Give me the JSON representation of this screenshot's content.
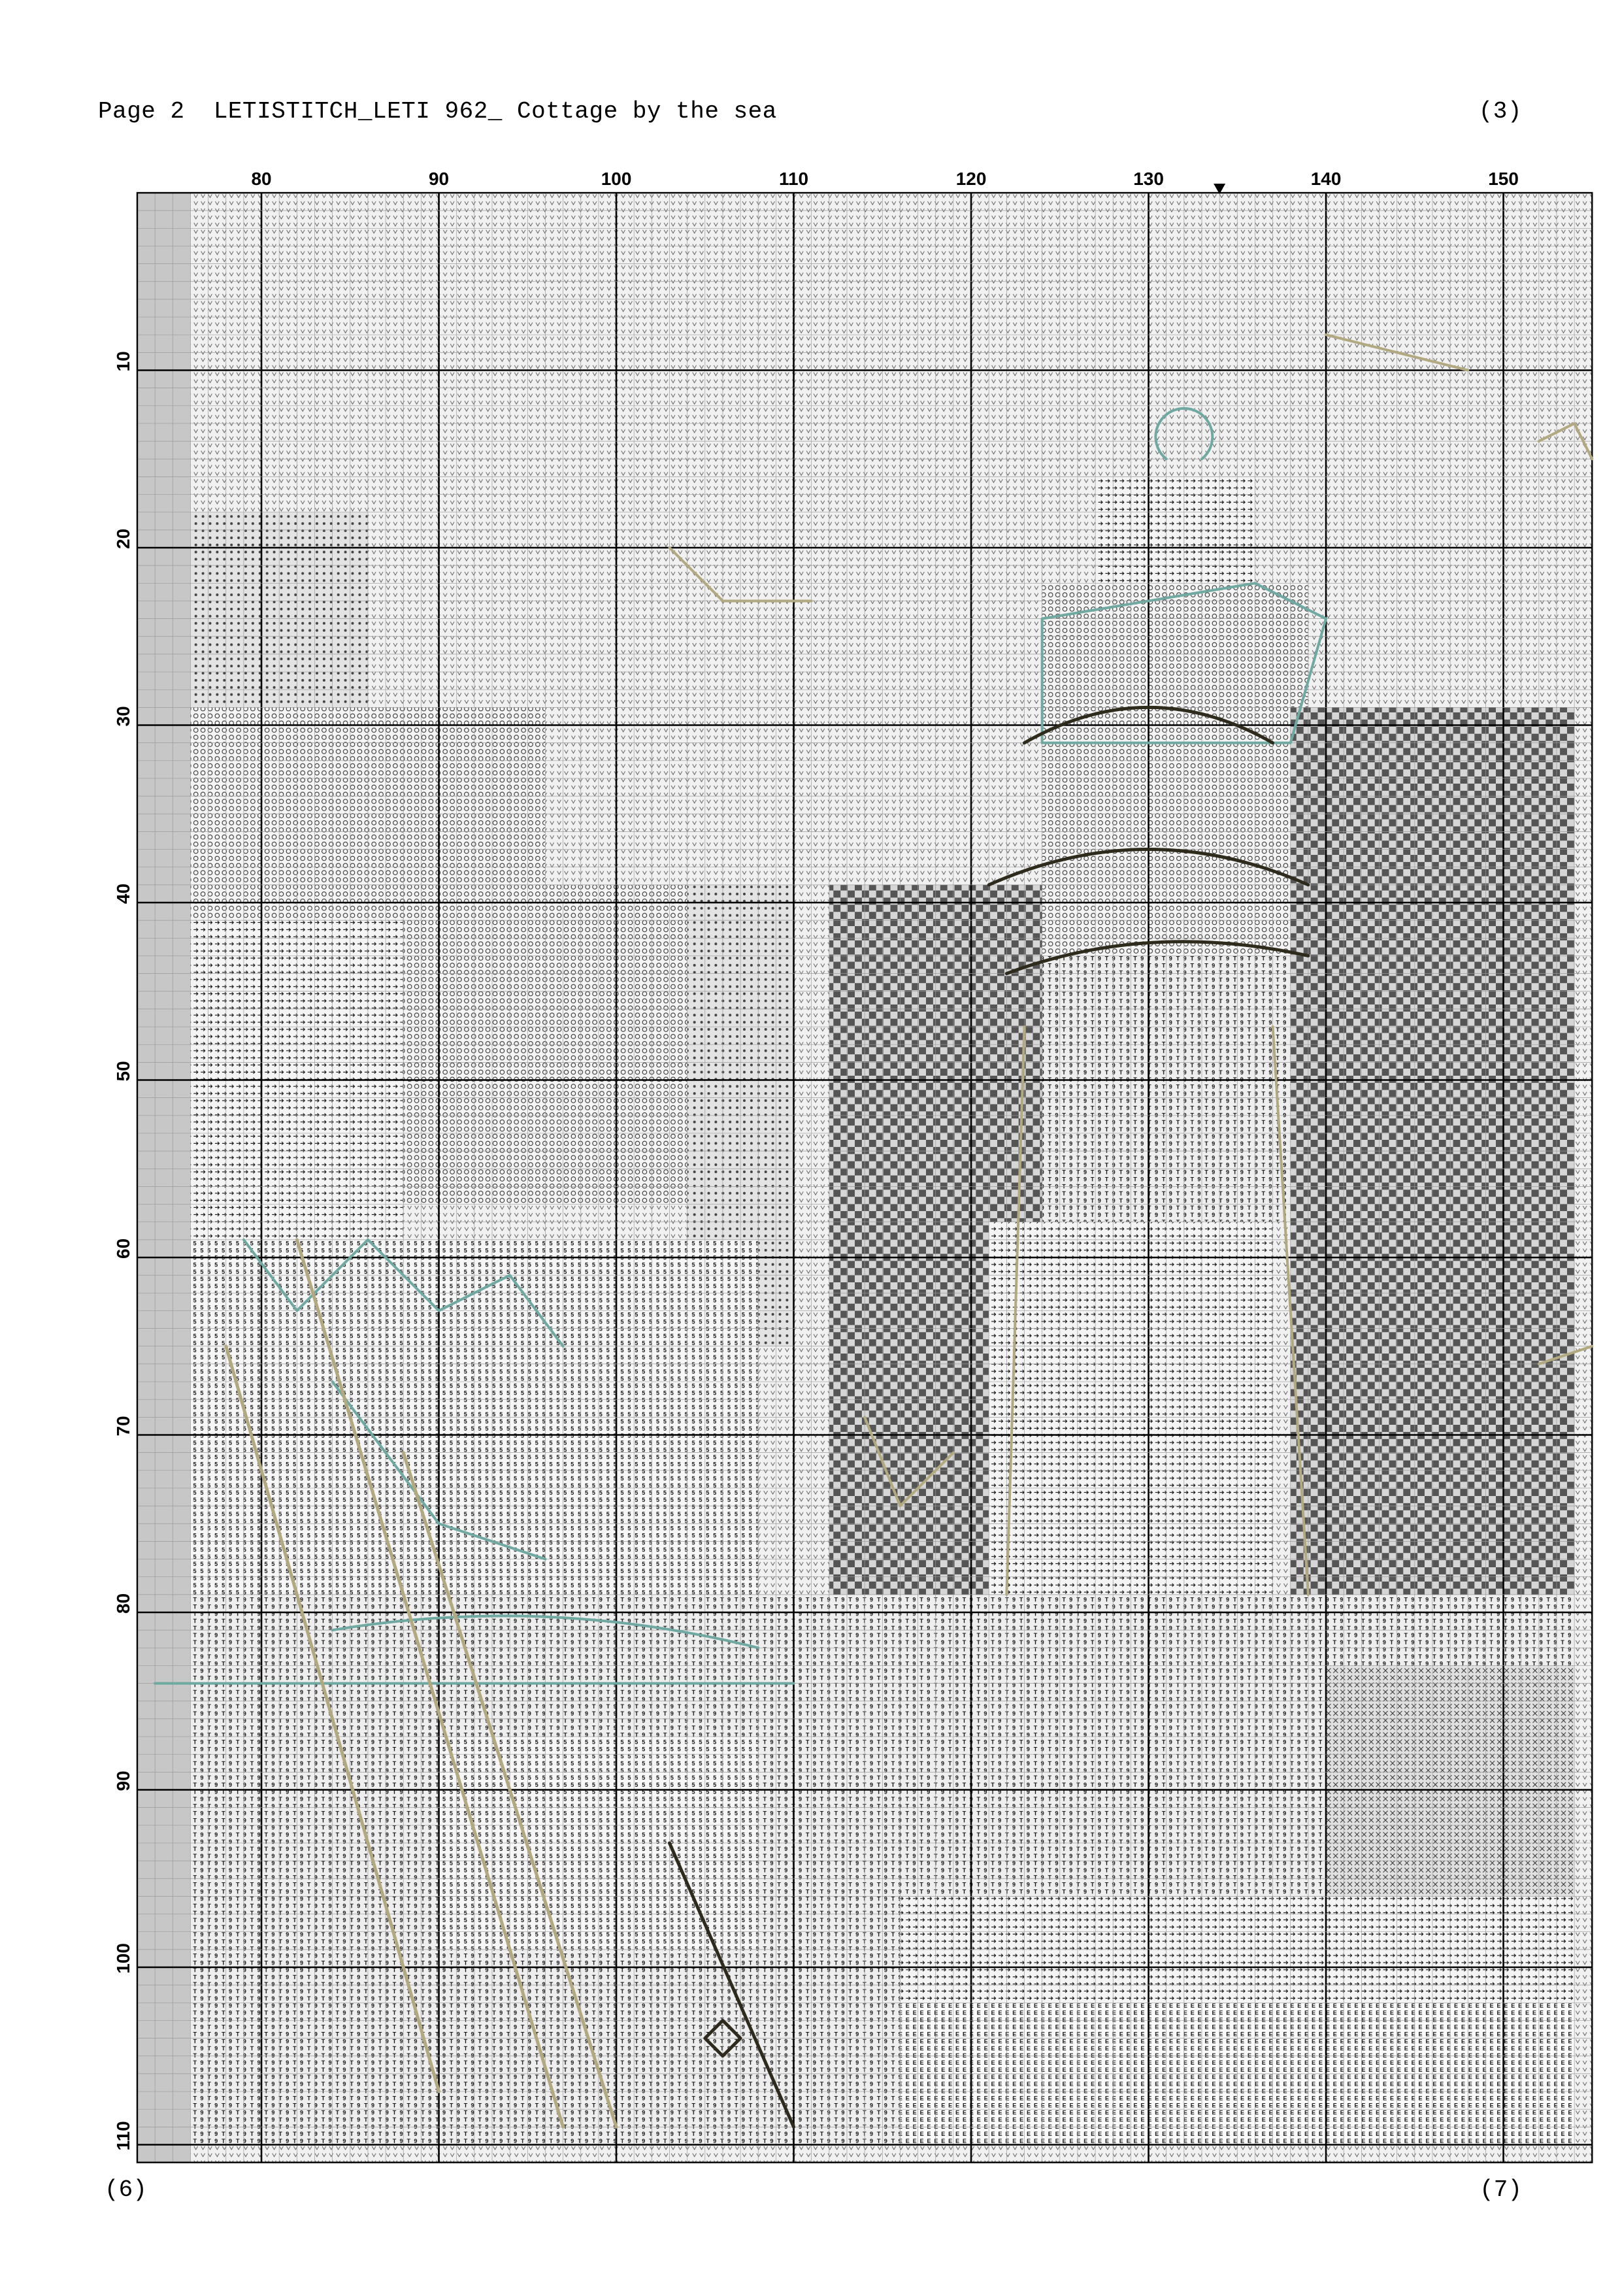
{
  "header": {
    "title": "Page 2  LETISTITCH_LETI 962_ Cottage by the sea",
    "right_ref": "(3)"
  },
  "footer": {
    "left_ref": "(6)",
    "right_ref": "(7)"
  },
  "pattern": {
    "col_labels": [
      "80",
      "90",
      "100",
      "110",
      "120",
      "130",
      "140",
      "150"
    ],
    "row_labels": [
      "10",
      "20",
      "30",
      "40",
      "50",
      "60",
      "70",
      "80",
      "90",
      "100",
      "110"
    ],
    "center_marker": "column 134",
    "colors": {
      "grid_minor": "#9a9a9a",
      "grid_major": "#000000",
      "backstitch_teal": "#6fa9a2",
      "backstitch_olive": "#b3a981",
      "backstitch_dark": "#2e2a1c",
      "sky_shade": "#e9e9e9",
      "mid_shade": "#b9b9b9",
      "dark_shade": "#6a6a6a",
      "overlap_strip": "#c7c7c7"
    }
  }
}
